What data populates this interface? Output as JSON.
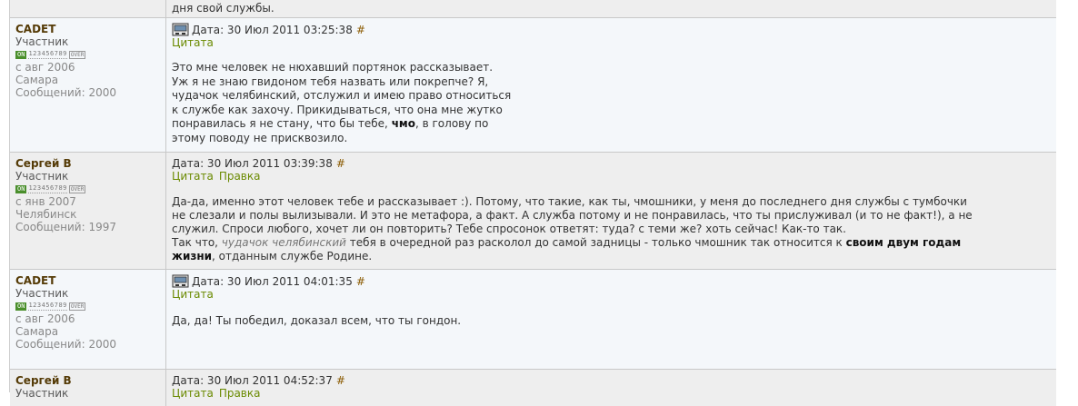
{
  "top_fragment": "дня свой службы.",
  "posts": [
    {
      "username": "CADET",
      "rank": "Участник",
      "status_on": "ON",
      "status_digits": "123456789",
      "status_over": "OVER",
      "since": "с авг 2006",
      "city": "Самара",
      "posts_count": "Сообщений: 2000",
      "has_pc_icon": true,
      "date": "Дата: 30 Июл 2011 03:25:38",
      "hash": "#",
      "links": [
        "Цитата"
      ],
      "body": [
        "Это мне человек не нюхавший портянок рассказывает.",
        "Уж я не знаю гвидоном тебя назвать или покрепче? Я,",
        "чудачок челябинский, отслужил и имею право относиться",
        "к службе как захочу. Прикидываться, что она мне жутко",
        "понравилась я не стану, что бы тебе, ",
        "чмо",
        ", в голову по",
        "этому поводу не присквозило."
      ]
    },
    {
      "username": "Сергей В",
      "rank": "Участник",
      "status_on": "ON",
      "status_digits": "123456789",
      "status_over": "OVER",
      "since": "с янв 2007",
      "city": "Челябинск",
      "posts_count": "Сообщений: 1997",
      "has_pc_icon": false,
      "date": "Дата: 30 Июл 2011 03:39:38",
      "hash": "#",
      "links": [
        "Цитата",
        "Правка"
      ],
      "body": [
        "Да-да, именно этот человек тебе и рассказывает :). Потому, что такие, как ты, чмошники, у меня до последнего дня службы с тумбочки",
        "не слезали и полы вылизывали. И это не метафора, а факт. А служба потому и не понравилась, что ты прислуживал (и то не факт!), а не",
        "служил. Спроси любого, хочет ли он повторить? Тебе спросонок ответят: туда? с теми же? хоть сейчас! Как-то так.",
        "Так что, ",
        "чудачок челябинский",
        " тебя в очередной раз расколол до самой задницы - только чмошник так относится к ",
        "своим двум годам",
        "жизни",
        ", отданным службе Родине."
      ]
    },
    {
      "username": "CADET",
      "rank": "Участник",
      "status_on": "ON",
      "status_digits": "123456789",
      "status_over": "OVER",
      "since": "с авг 2006",
      "city": "Самара",
      "posts_count": "Сообщений: 2000",
      "has_pc_icon": true,
      "date": "Дата: 30 Июл 2011 04:01:35",
      "hash": "#",
      "links": [
        "Цитата"
      ],
      "body": [
        "Да, да! Ты победил, доказал всем, что ты гондон."
      ]
    },
    {
      "username": "Сергей В",
      "rank": "Участник",
      "has_pc_icon": false,
      "date": "Дата: 30 Июл 2011 04:52:37",
      "hash": "#",
      "links": [
        "Цитата",
        "Правка"
      ]
    }
  ]
}
